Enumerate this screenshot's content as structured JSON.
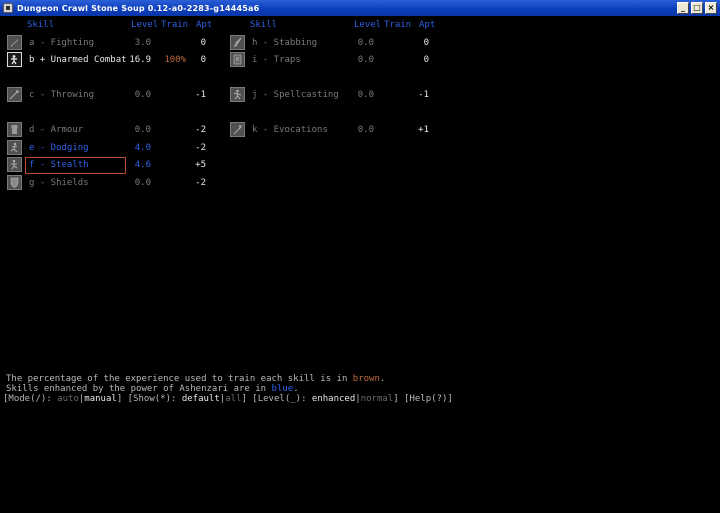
{
  "window": {
    "title": "Dungeon Crawl Stone Soup 0.12-a0-2283-g14445a6",
    "buttons": {
      "minimize": "_",
      "maximize": "□",
      "close": "×"
    }
  },
  "headers": {
    "skill": "Skill",
    "level": "Level",
    "train": "Train",
    "apt": "Apt"
  },
  "skills_left": [
    {
      "label": "a - Fighting",
      "level": "3.0",
      "train": "",
      "apt": "0",
      "style": "grey",
      "icon": "sword-icon"
    },
    {
      "label": "b + Unarmed Combat",
      "level": "16.9",
      "train": "100%",
      "apt": "0",
      "style": "white",
      "icon": "fist-icon"
    },
    {
      "label": "c - Throwing",
      "level": "0.0",
      "train": "",
      "apt": "-1",
      "style": "grey",
      "icon": "dart-icon"
    },
    {
      "label": "d - Armour",
      "level": "0.0",
      "train": "",
      "apt": "-2",
      "style": "grey",
      "icon": "armour-icon"
    },
    {
      "label": "e - Dodging",
      "level": "4.0",
      "train": "",
      "apt": "-2",
      "style": "blue",
      "icon": "dodge-icon"
    },
    {
      "label": "f - Stealth",
      "level": "4.6",
      "train": "",
      "apt": "+5",
      "style": "blue",
      "icon": "stealth-icon"
    },
    {
      "label": "g - Shields",
      "level": "0.0",
      "train": "",
      "apt": "-2",
      "style": "grey",
      "icon": "shield-icon"
    }
  ],
  "skills_right": [
    {
      "label": "h - Stabbing",
      "level": "0.0",
      "train": "",
      "apt": "0",
      "style": "grey",
      "icon": "dagger-icon"
    },
    {
      "label": "i - Traps",
      "level": "0.0",
      "train": "",
      "apt": "0",
      "style": "grey",
      "icon": "trap-icon"
    },
    {
      "label": "j - Spellcasting",
      "level": "0.0",
      "train": "",
      "apt": "-1",
      "style": "grey",
      "icon": "spellbook-icon"
    },
    {
      "label": "k - Evocations",
      "level": "0.0",
      "train": "",
      "apt": "+1",
      "style": "grey",
      "icon": "wand-icon"
    }
  ],
  "footer": {
    "line1_prefix": "The percentage of the experience used to train each skill is in ",
    "line1_word": "brown",
    "line1_suffix": ".",
    "line2_prefix": "Skills enhanced by the power of Ashenzari are in ",
    "line2_word": "blue",
    "line2_suffix": ".",
    "mode_label": "[Mode(/): ",
    "mode_auto": "auto",
    "mode_sep": "|",
    "mode_manual": "manual",
    "show_label": "] [Show(*): ",
    "show_default": "default",
    "show_sep": "|",
    "show_all": "all",
    "level_label": "] [Level(_): ",
    "level_enhanced": "enhanced",
    "level_sep": "|",
    "level_normal": "normal",
    "help_label": "] [Help(?)]"
  },
  "colors": {
    "header_blue": "#2f5fe0",
    "enhanced_blue": "#3060e8",
    "train_brown": "#c06a3a",
    "selection_border": "#b84a3a"
  }
}
